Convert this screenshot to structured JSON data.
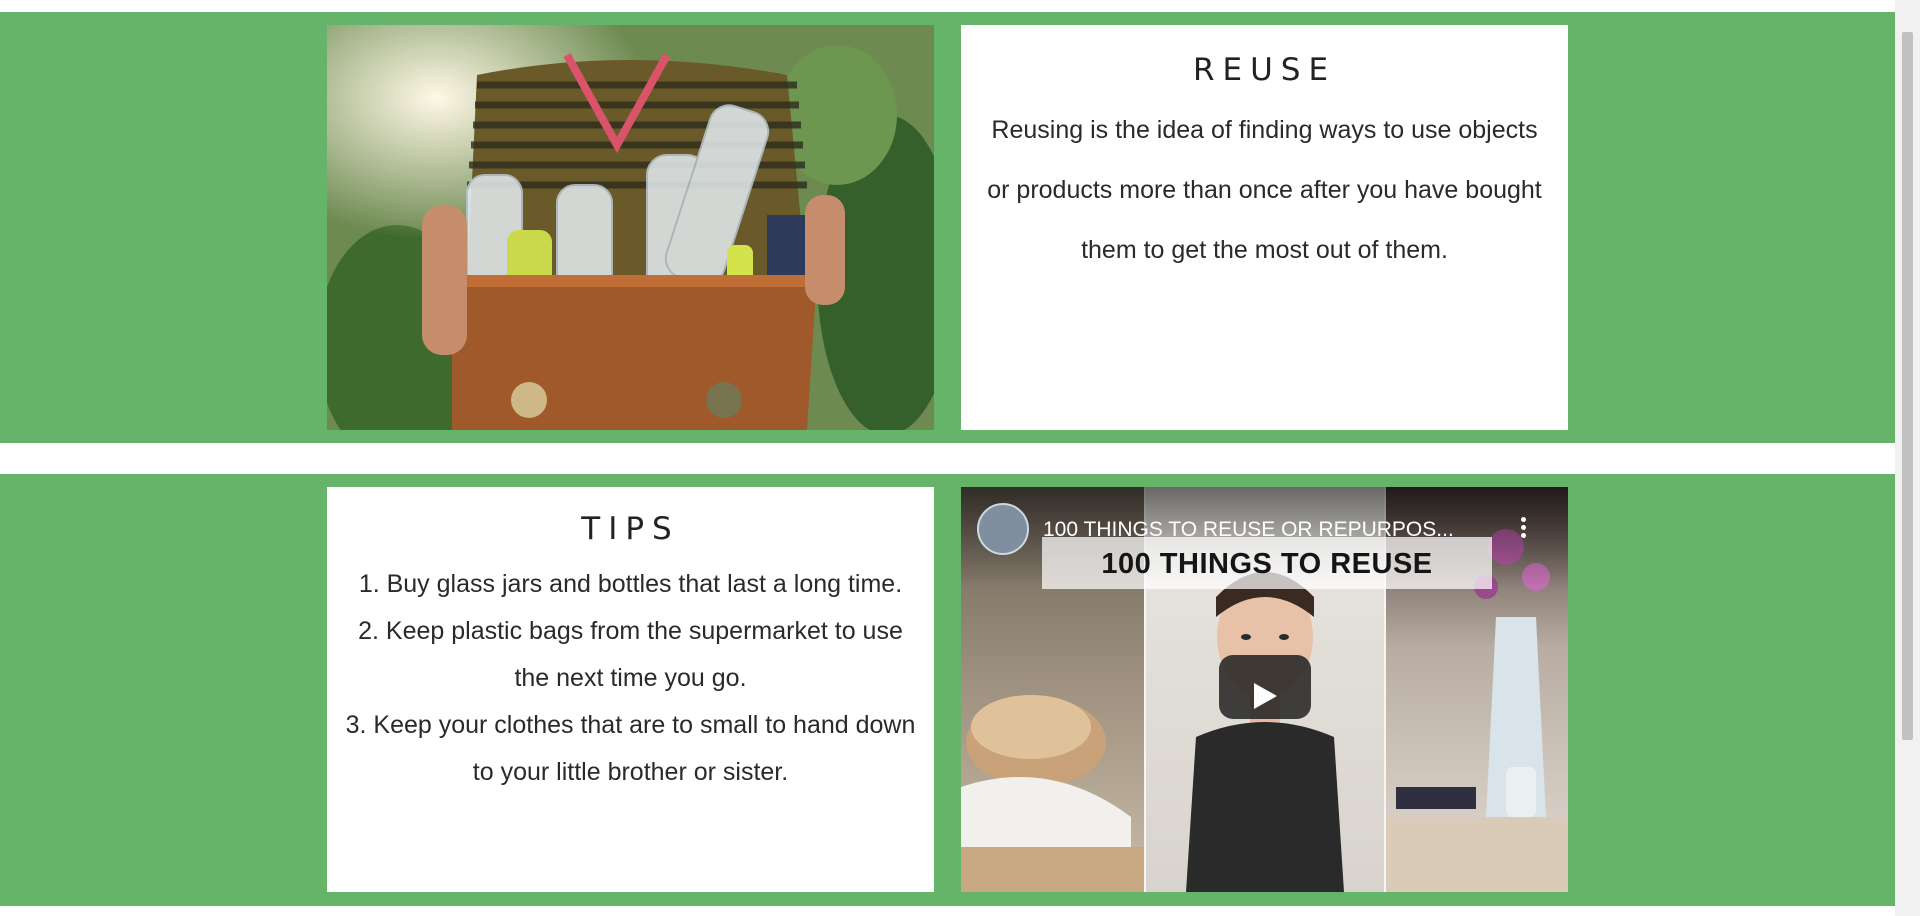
{
  "reuse": {
    "heading": "REUSE",
    "body": "Reusing is the idea of finding ways to use objects or products more than once after you have bought them to get the most out of them."
  },
  "tips": {
    "heading": "TIPS",
    "items": [
      "1. Buy glass jars and bottles that last a long time.",
      "2. Keep plastic bags from the supermarket to use the next time you go.",
      "3. Keep your clothes that are to small to hand down to your little brother or sister."
    ]
  },
  "video": {
    "title": "100 THINGS TO REUSE OR REPURPOS...",
    "banner": "100 THINGS TO REUSE"
  },
  "colors": {
    "band_green": "#66b36a",
    "panel_white": "#ffffff"
  }
}
